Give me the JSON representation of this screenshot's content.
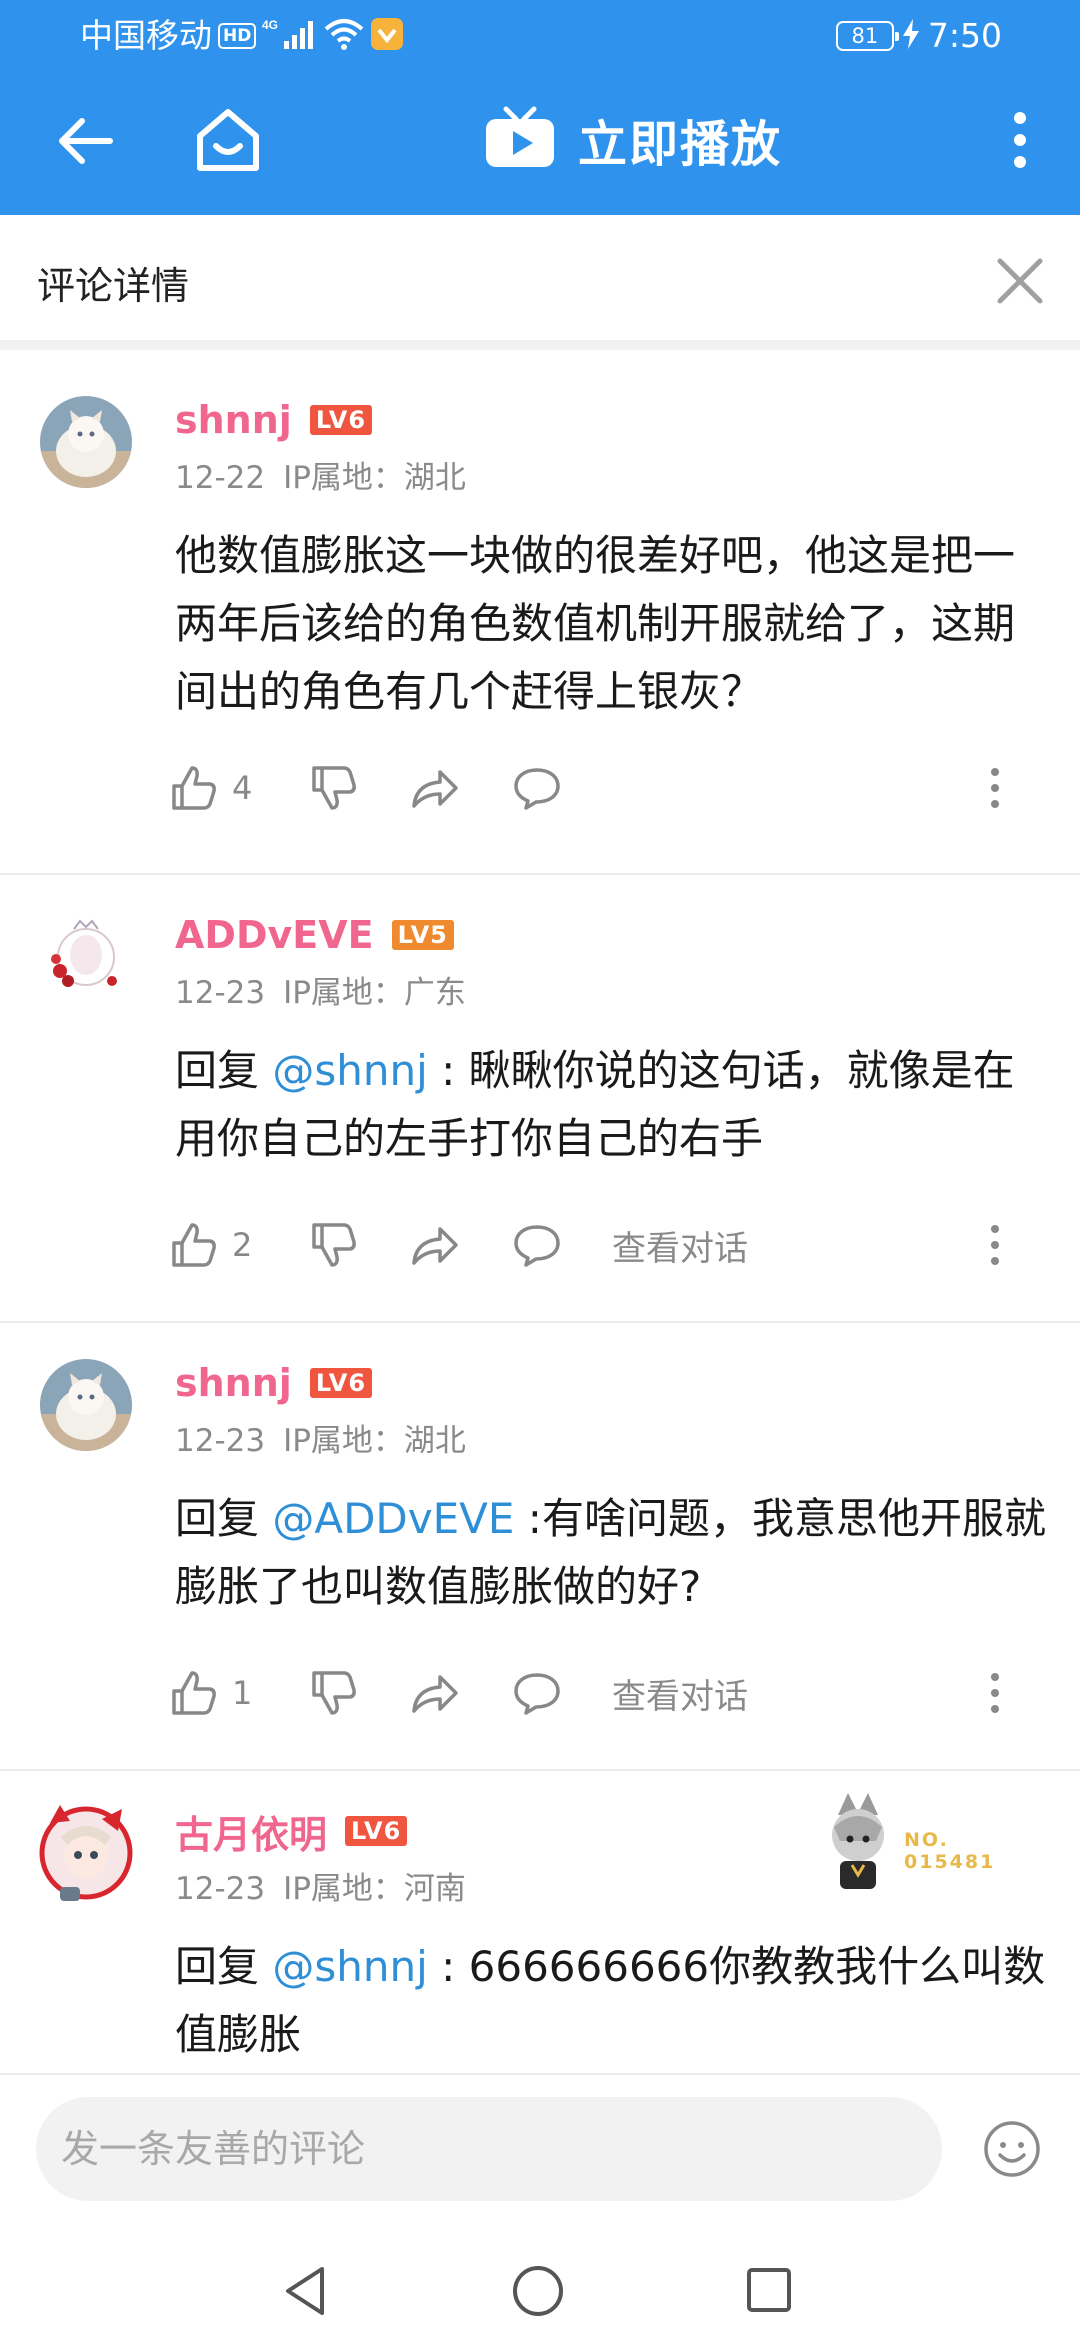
{
  "status_bar": {
    "carrier": "中国移动",
    "hd": "HD",
    "network": "4G",
    "battery": "81",
    "time": "7:50"
  },
  "app_bar": {
    "title": "立即播放",
    "back_icon": "arrow-left-icon",
    "home_icon": "home-icon",
    "tv_icon": "tv-play-icon",
    "more_icon": "more-vertical-icon",
    "color": "#2f93ee"
  },
  "detail_header": {
    "title": "评论详情",
    "close_icon": "close-icon"
  },
  "comments": [
    {
      "user": "shnnj",
      "level": "LV6",
      "date": "12-22",
      "ip": "IP属地：湖北",
      "reply_prefix": "",
      "mention": "",
      "text": "他数值膨胀这一块做的很差好吧，他这是把一两年后该给的角色数值机制开服就给了，这期间出的角色有几个赶得上银灰？",
      "likes": "4",
      "view_conversation": ""
    },
    {
      "user": "ADDvEVE",
      "level": "LV5",
      "date": "12-23",
      "ip": "IP属地：广东",
      "reply_prefix": "回复 ",
      "mention": "@shnnj",
      "text": " : 瞅瞅你说的这句话，就像是在用你自己的左手打你自己的右手",
      "likes": "2",
      "view_conversation": "查看对话"
    },
    {
      "user": "shnnj",
      "level": "LV6",
      "date": "12-23",
      "ip": "IP属地：湖北",
      "reply_prefix": "回复 ",
      "mention": "@ADDvEVE",
      "text": " :有啥问题，我意思他开服就膨胀了也叫数值膨胀做的好?",
      "likes": "1",
      "view_conversation": "查看对话"
    },
    {
      "user": "古月依明",
      "level": "LV6",
      "date": "12-23",
      "ip": "IP属地：河南",
      "reply_prefix": "回复 ",
      "mention": "@shnnj",
      "text": " : 666666666你教教我什么叫数值膨胀",
      "likes": "",
      "view_conversation": "",
      "medal_line1": "NO.",
      "medal_line2": "015481"
    }
  ],
  "input": {
    "placeholder": "发一条友善的评论",
    "emoji_icon": "emoji-icon"
  },
  "colors": {
    "username": "#f0668f",
    "mention": "#2f8fd6",
    "lv6": "#f0553f",
    "lv5": "#f08a2e"
  }
}
